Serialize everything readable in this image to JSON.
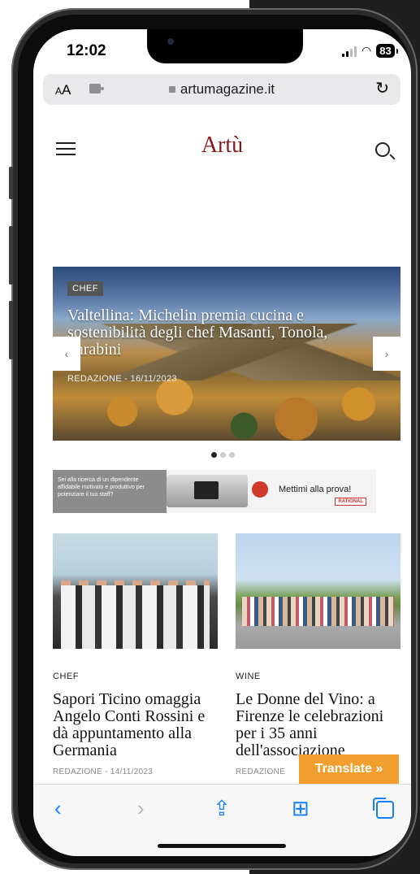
{
  "status": {
    "time": "12:02",
    "battery": "83"
  },
  "browser": {
    "aa_small": "A",
    "aa_large": "A",
    "url": "artumagazine.it",
    "reload": "↻"
  },
  "site": {
    "logo": "Artù"
  },
  "hero": {
    "tag": "CHEF",
    "title": "Valtellina: Michelin premia cucina e sostenibilità degli chef Masanti, Tonola, Tarabini",
    "meta": "REDAZIONE - 16/11/2023",
    "prev": "‹",
    "next": "›",
    "slides": 3,
    "active_slide": 1
  },
  "banner": {
    "left_text": "Sei alla ricerca di un dipendente affidabile motivato e produttivo per potenziare il tuo staff?",
    "cta": "Mettimi alla prova!",
    "brand": "RATIONAL"
  },
  "articles": [
    {
      "tag": "CHEF",
      "title": "Sapori Ticino omaggia Angelo Conti Rossini e dà appuntamento alla Germania",
      "meta": "REDAZIONE - 14/11/2023"
    },
    {
      "tag": "WINE",
      "title": "Le Donne del Vino: a Firenze le celebrazioni per i 35 anni dell'associazione",
      "meta": "REDAZIONE"
    }
  ],
  "translate": {
    "label": "Translate »"
  },
  "toolbar": {
    "back": "‹",
    "forward": "›",
    "share": "⇪",
    "bookmarks": "⊞"
  },
  "colors": {
    "logo": "#8b1a1a",
    "accent": "#147efb",
    "translate": "#f29e2e"
  }
}
